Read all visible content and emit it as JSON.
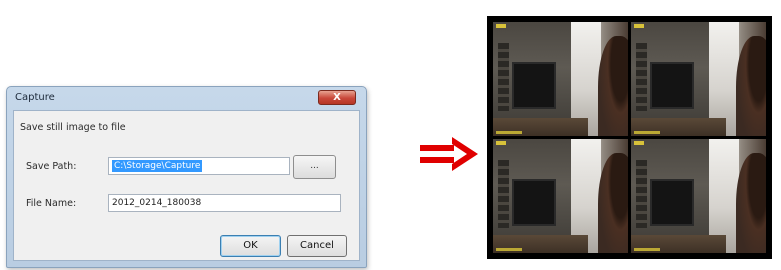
{
  "dialog": {
    "title": "Capture",
    "close_symbol": "X",
    "caption": "Save still image to file",
    "save_path_label": "Save Path:",
    "save_path_value": "C:\\Storage\\Capture",
    "browse_label": "...",
    "file_name_label": "File Name:",
    "file_name_value": "2012_0214_180038",
    "ok_label": "OK",
    "cancel_label": "Cancel"
  },
  "arrow": {
    "color": "#e00000",
    "icon": "double-arrow-right-icon"
  },
  "preview": {
    "layout": "2x2",
    "channels": 4
  }
}
